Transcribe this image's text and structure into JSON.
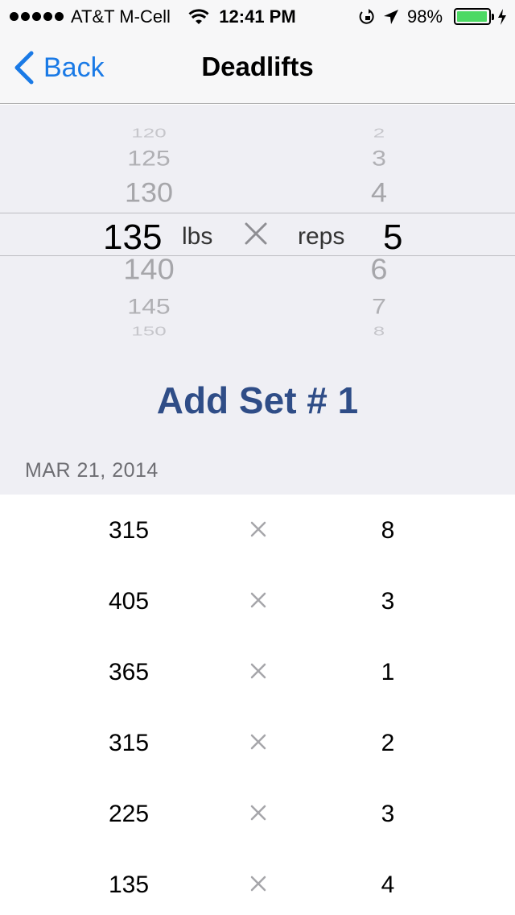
{
  "status_bar": {
    "carrier": "AT&T M-Cell",
    "time": "12:41 PM",
    "battery_percent": "98%",
    "battery_level": 0.98,
    "icons": [
      "signal-dots",
      "wifi-icon",
      "rotation-lock-icon",
      "location-icon",
      "battery-icon",
      "charging-icon"
    ]
  },
  "nav": {
    "back_label": "Back",
    "title": "Deadlifts"
  },
  "picker": {
    "weights": [
      "120",
      "125",
      "130",
      "135",
      "140",
      "145",
      "150"
    ],
    "selected_weight": "135",
    "weight_unit": "lbs",
    "reps_label": "reps",
    "reps": [
      "2",
      "3",
      "4",
      "5",
      "6",
      "7",
      "8"
    ],
    "selected_reps": "5"
  },
  "add_set_label": "Add Set # 1",
  "history": {
    "date": "MAR 21, 2014",
    "sets": [
      {
        "weight": "315",
        "reps": "8"
      },
      {
        "weight": "405",
        "reps": "3"
      },
      {
        "weight": "365",
        "reps": "1"
      },
      {
        "weight": "315",
        "reps": "2"
      },
      {
        "weight": "225",
        "reps": "3"
      },
      {
        "weight": "135",
        "reps": "4"
      }
    ]
  },
  "colors": {
    "accent_blue": "#1a7ae6",
    "add_set_blue": "#2f4d87",
    "picker_background": "#efeff4",
    "battery_green": "#4cd964"
  }
}
